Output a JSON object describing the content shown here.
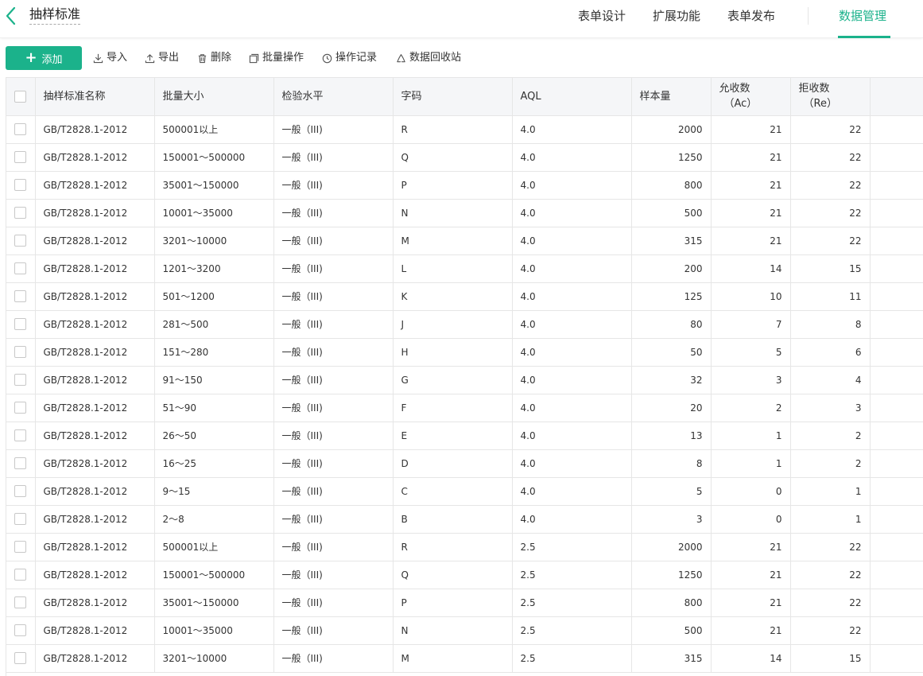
{
  "header": {
    "title": "抽样标准",
    "nav": [
      {
        "label": "表单设计",
        "active": false
      },
      {
        "label": "扩展功能",
        "active": false
      },
      {
        "label": "表单发布",
        "active": false
      },
      {
        "label": "数据管理",
        "active": true
      }
    ]
  },
  "toolbar": {
    "add_label": "添加",
    "import_label": "导入",
    "export_label": "导出",
    "delete_label": "删除",
    "batch_label": "批量操作",
    "log_label": "操作记录",
    "recycle_label": "数据回收站"
  },
  "colors": {
    "accent": "#1bb28b"
  },
  "table": {
    "columns": [
      "抽样标准名称",
      "批量大小",
      "检验水平",
      "字码",
      "AQL",
      "样本量",
      "允收数",
      "（Ac）",
      "拒收数",
      "（Re）"
    ],
    "rows": [
      [
        "GB/T2828.1-2012",
        "500001以上",
        "一般（III)",
        "R",
        "4.0",
        "2000",
        "21",
        "22"
      ],
      [
        "GB/T2828.1-2012",
        "150001～500000",
        "一般（III)",
        "Q",
        "4.0",
        "1250",
        "21",
        "22"
      ],
      [
        "GB/T2828.1-2012",
        "35001～150000",
        "一般（III)",
        "P",
        "4.0",
        "800",
        "21",
        "22"
      ],
      [
        "GB/T2828.1-2012",
        "10001～35000",
        "一般（III)",
        "N",
        "4.0",
        "500",
        "21",
        "22"
      ],
      [
        "GB/T2828.1-2012",
        "3201～10000",
        "一般（III)",
        "M",
        "4.0",
        "315",
        "21",
        "22"
      ],
      [
        "GB/T2828.1-2012",
        "1201～3200",
        "一般（III)",
        "L",
        "4.0",
        "200",
        "14",
        "15"
      ],
      [
        "GB/T2828.1-2012",
        "501～1200",
        "一般（III)",
        "K",
        "4.0",
        "125",
        "10",
        "11"
      ],
      [
        "GB/T2828.1-2012",
        "281～500",
        "一般（III)",
        "J",
        "4.0",
        "80",
        "7",
        "8"
      ],
      [
        "GB/T2828.1-2012",
        "151～280",
        "一般（III)",
        "H",
        "4.0",
        "50",
        "5",
        "6"
      ],
      [
        "GB/T2828.1-2012",
        "91～150",
        "一般（III)",
        "G",
        "4.0",
        "32",
        "3",
        "4"
      ],
      [
        "GB/T2828.1-2012",
        "51～90",
        "一般（III)",
        "F",
        "4.0",
        "20",
        "2",
        "3"
      ],
      [
        "GB/T2828.1-2012",
        "26～50",
        "一般（III)",
        "E",
        "4.0",
        "13",
        "1",
        "2"
      ],
      [
        "GB/T2828.1-2012",
        "16～25",
        "一般（III)",
        "D",
        "4.0",
        "8",
        "1",
        "2"
      ],
      [
        "GB/T2828.1-2012",
        "9～15",
        "一般（III)",
        "C",
        "4.0",
        "5",
        "0",
        "1"
      ],
      [
        "GB/T2828.1-2012",
        "2～8",
        "一般（III)",
        "B",
        "4.0",
        "3",
        "0",
        "1"
      ],
      [
        "GB/T2828.1-2012",
        "500001以上",
        "一般（III)",
        "R",
        "2.5",
        "2000",
        "21",
        "22"
      ],
      [
        "GB/T2828.1-2012",
        "150001～500000",
        "一般（III)",
        "Q",
        "2.5",
        "1250",
        "21",
        "22"
      ],
      [
        "GB/T2828.1-2012",
        "35001～150000",
        "一般（III)",
        "P",
        "2.5",
        "800",
        "21",
        "22"
      ],
      [
        "GB/T2828.1-2012",
        "10001～35000",
        "一般（III)",
        "N",
        "2.5",
        "500",
        "21",
        "22"
      ],
      [
        "GB/T2828.1-2012",
        "3201～10000",
        "一般（III)",
        "M",
        "2.5",
        "315",
        "14",
        "15"
      ]
    ]
  }
}
